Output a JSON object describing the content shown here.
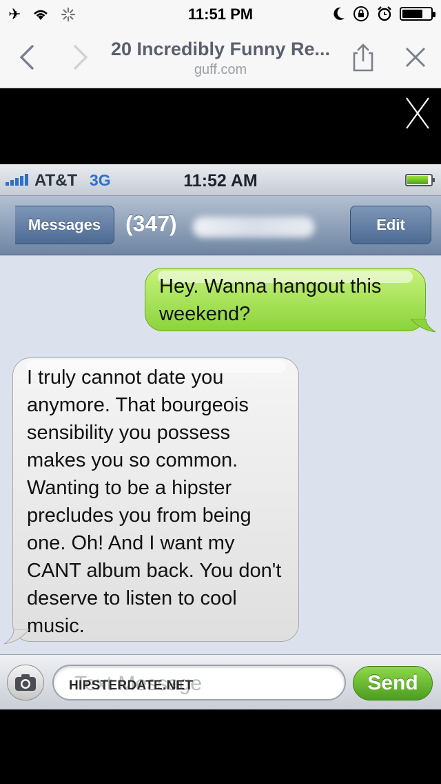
{
  "status_bar": {
    "time": "11:51 PM",
    "icons": [
      "airplane-icon",
      "wifi-icon",
      "loading-spinner-icon",
      "moon-icon",
      "rotation-lock-icon",
      "alarm-icon",
      "battery-icon"
    ],
    "battery_level": 0.75
  },
  "browser": {
    "title": "20 Incredibly Funny Re...",
    "domain": "guff.com",
    "close_glyph": "X"
  },
  "embedded_screenshot": {
    "status_bar": {
      "carrier": "AT&T",
      "network": "3G",
      "time": "11:52 AM",
      "battery_level": 0.9
    },
    "nav": {
      "back_label": "Messages",
      "contact": "(347)",
      "edit_label": "Edit"
    },
    "messages": [
      {
        "direction": "sent",
        "text": "Hey. Wanna hangout this weekend?"
      },
      {
        "direction": "received",
        "text": "I truly cannot date you anymore. That bourgeois sensibility you possess makes you so common. Wanting to be a hipster precludes you from being one. Oh! And I want my CANT album back. You don't deserve to listen to cool music."
      }
    ],
    "input": {
      "placeholder": "Text Message",
      "watermark": "HIPSTERDATE.NET",
      "send_label": "Send"
    },
    "colors": {
      "sent_bubble": "#8bd43c",
      "received_bubble": "#e8e8e8",
      "nav_bar": "#6d84a2",
      "send_button": "#4c9d1f"
    }
  }
}
